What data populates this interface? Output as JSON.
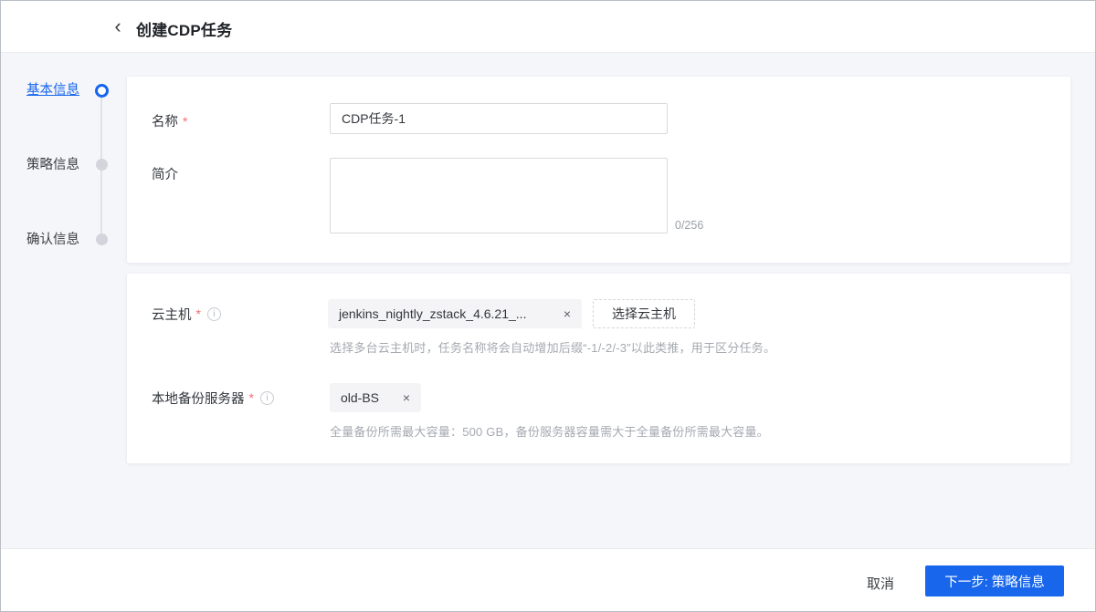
{
  "header": {
    "title": "创建CDP任务"
  },
  "stepper": {
    "steps": [
      {
        "label": "基本信息",
        "state": "active"
      },
      {
        "label": "策略信息",
        "state": "pending"
      },
      {
        "label": "确认信息",
        "state": "pending"
      }
    ]
  },
  "basic": {
    "name_label": "名称",
    "name_value": "CDP任务-1",
    "desc_label": "简介",
    "desc_value": "",
    "desc_counter": "0/256"
  },
  "resources": {
    "vm_label": "云主机",
    "vm_tag_label": "jenkins_nightly_zstack_4.6.21_...",
    "vm_select_button": "选择云主机",
    "vm_hint": "选择多台云主机时，任务名称将会自动增加后缀“-1/-2/-3”以此类推，用于区分任务。",
    "bs_label": "本地备份服务器",
    "bs_tag_label": "old-BS",
    "bs_hint": "全量备份所需最大容量：500 GB，备份服务器容量需大于全量备份所需最大容量。"
  },
  "footer": {
    "cancel_label": "取消",
    "next_label": "下一步: 策略信息"
  },
  "icons": {
    "back": "‹",
    "close": "×",
    "required": "*",
    "info": "i"
  },
  "colors": {
    "accent": "#1766ec",
    "required": "#f56c6c"
  }
}
